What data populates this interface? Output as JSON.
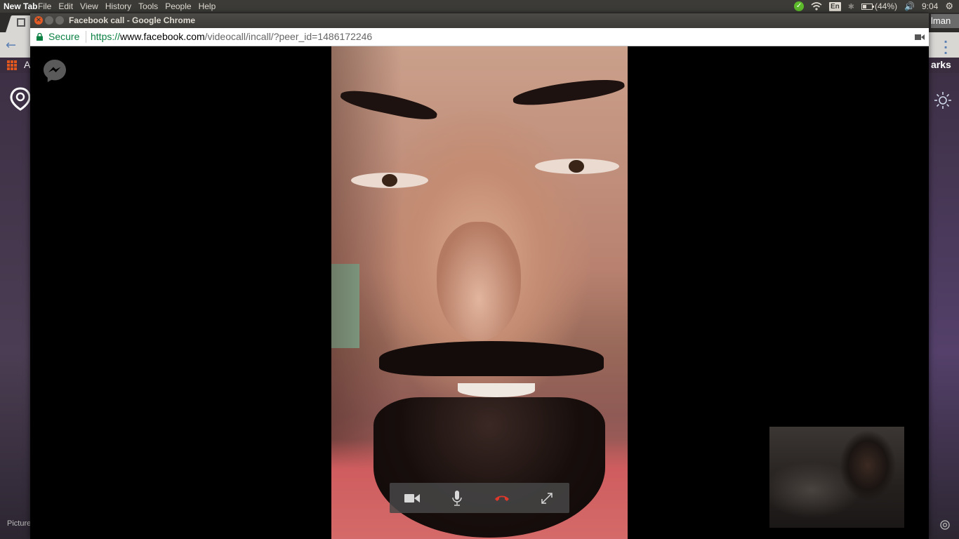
{
  "os_panel": {
    "app_title": "New Tab",
    "menu": [
      "File",
      "Edit",
      "View",
      "History",
      "Tools",
      "People",
      "Help"
    ],
    "language": "En",
    "battery": "(44%)",
    "volume_icon": "speaker-icon",
    "time": "9:04"
  },
  "background_browser": {
    "apps_label": "A",
    "bookmarks_label": "arks",
    "user_label": "lman",
    "picture_label": "Picture"
  },
  "popup": {
    "title": "Facebook call - Google Chrome",
    "secure_label": "Secure",
    "url_scheme": "https://",
    "url_host": "www.facebook.com",
    "url_path": "/videocall/incall/?peer_id=1486172246"
  },
  "call": {
    "controls": [
      {
        "name": "video-toggle-button",
        "icon": "video-camera-icon"
      },
      {
        "name": "mute-button",
        "icon": "microphone-icon"
      },
      {
        "name": "end-call-button",
        "icon": "hang-up-icon"
      },
      {
        "name": "fullscreen-button",
        "icon": "expand-icon"
      }
    ]
  },
  "colors": {
    "secure_green": "#0b8043",
    "panel_bg": "#3c3b37",
    "end_call_red": "#e0392b",
    "messenger_icon": "#555555"
  }
}
